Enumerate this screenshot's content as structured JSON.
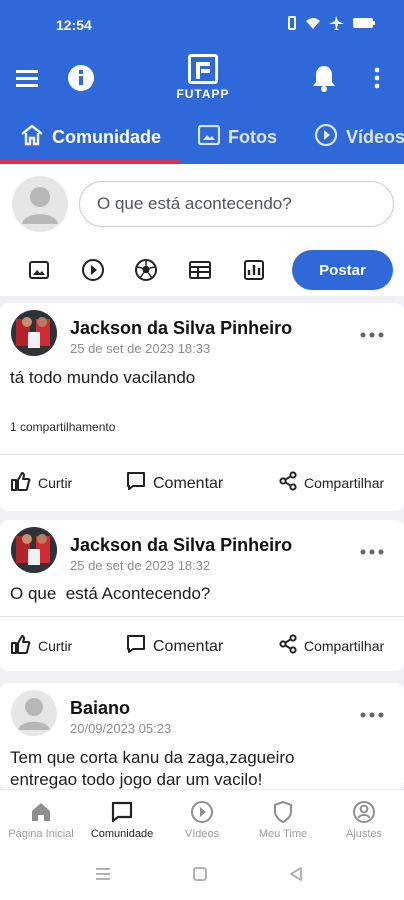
{
  "status_bar": {
    "time": "12:54",
    "icons": [
      "vibrate-icon",
      "wifi-icon",
      "airplane-icon",
      "battery-icon"
    ]
  },
  "app_bar": {
    "logo_text": "FUTAPP",
    "icons": [
      "menu-icon",
      "info-icon",
      "bell-icon",
      "more-vertical-icon"
    ],
    "brand_color": "#2f68d8"
  },
  "tabs": [
    {
      "label": "Comunidade",
      "icon": "home-icon",
      "active": true
    },
    {
      "label": "Fotos",
      "icon": "image-icon",
      "active": false
    },
    {
      "label": "Vídeos",
      "icon": "play-circle-icon",
      "active": false
    }
  ],
  "composer": {
    "placeholder": "O que está acontecendo?",
    "button_label": "Postar",
    "tools": [
      "image-icon",
      "play-circle-icon",
      "soccer-ball-icon",
      "table-icon",
      "chart-icon"
    ]
  },
  "posts": [
    {
      "author": "Jackson da Silva Pinheiro",
      "time": "25 de set de 2023 18:33",
      "text": "tá todo mundo vacilando",
      "shares": "1 compartilhamento",
      "actions": {
        "like": "Curtir",
        "comment": "Comentar",
        "share": "Compartilhar"
      }
    },
    {
      "author": "Jackson da Silva Pinheiro",
      "time": "25 de set de 2023 18:32",
      "text": "O que  está Acontecendo?",
      "actions": {
        "like": "Curtir",
        "comment": "Comentar",
        "share": "Compartilhar"
      }
    },
    {
      "author": "Baiano",
      "time": "20/09/2023 05:23",
      "text_lines": [
        "Tem que corta kanu da zaga,zagueiro",
        "entregao todo jogo dar um vacilo!"
      ]
    }
  ],
  "bottom_nav": [
    {
      "label": "Página Inicial",
      "icon": "home-icon",
      "active": false
    },
    {
      "label": "Comunidade",
      "icon": "chat-icon",
      "active": true
    },
    {
      "label": "Vídeos",
      "icon": "play-circle-icon",
      "active": false
    },
    {
      "label": "Meu Time",
      "icon": "shield-icon",
      "active": false
    },
    {
      "label": "Ajustes",
      "icon": "user-circle-icon",
      "active": false
    }
  ],
  "system_nav": [
    "menu-lines-icon",
    "square-icon",
    "back-triangle-icon"
  ],
  "colors": {
    "primary": "#2f68d8",
    "tab_indicator": "#e0304e",
    "text": "#111111",
    "muted": "#8a8d91"
  }
}
